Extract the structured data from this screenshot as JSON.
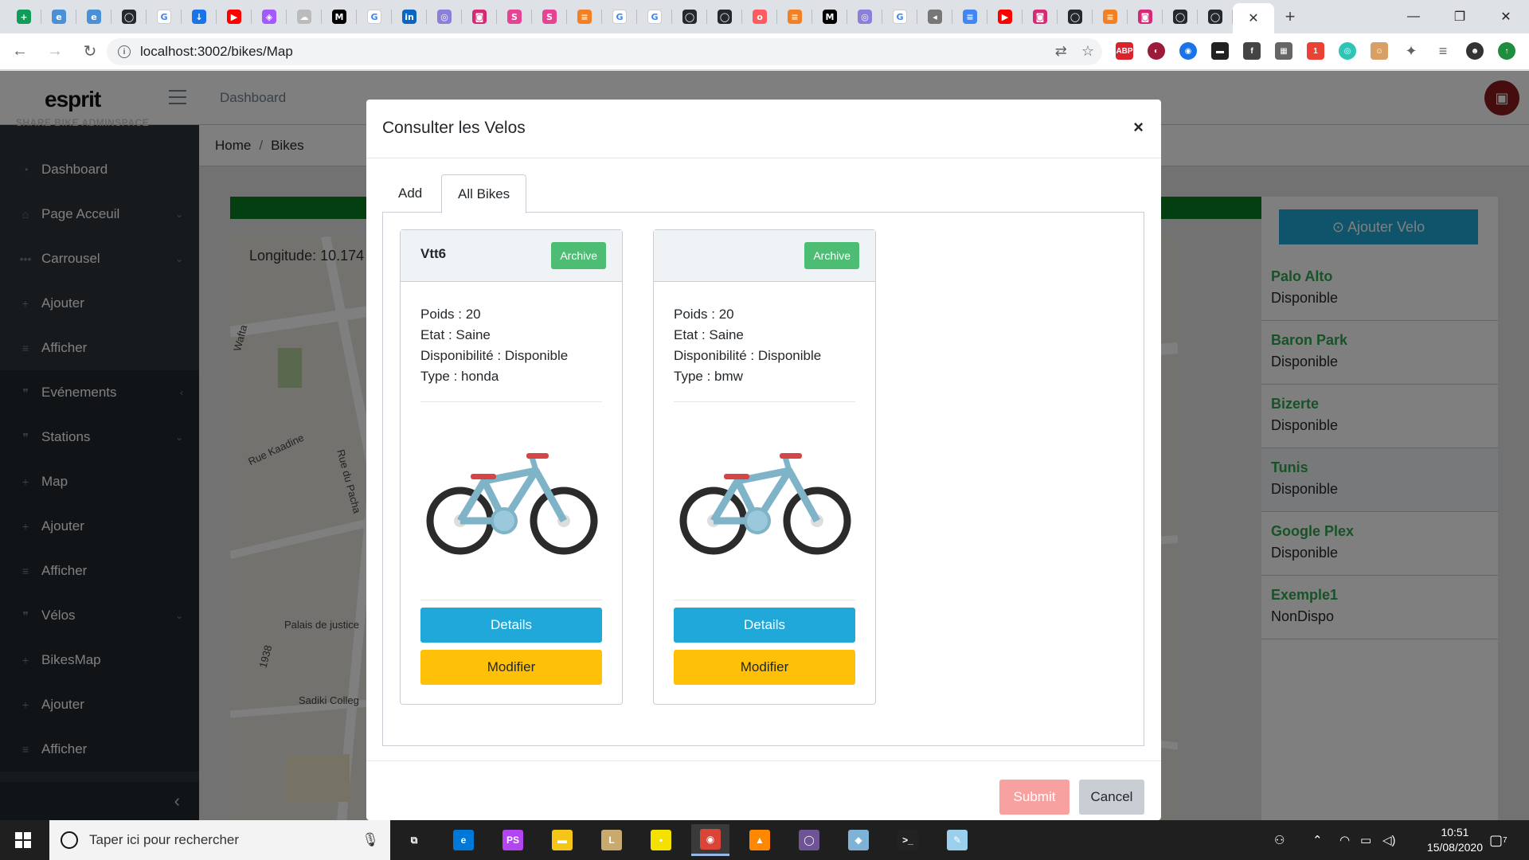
{
  "browser": {
    "tabs": [
      {
        "icon": "sheets-icon",
        "color": "#0f9d58",
        "glyph": "+"
      },
      {
        "icon": "edge-icon",
        "color": "#4a90d9",
        "glyph": "e"
      },
      {
        "icon": "edge-icon",
        "color": "#4a90d9",
        "glyph": "e"
      },
      {
        "icon": "github-icon",
        "color": "#24292e",
        "glyph": "◯"
      },
      {
        "icon": "google-icon",
        "color": "#ffffff",
        "glyph": "G"
      },
      {
        "icon": "download-icon",
        "color": "#1a73e8",
        "glyph": "↓"
      },
      {
        "icon": "youtube-icon",
        "color": "#ff0000",
        "glyph": "▶"
      },
      {
        "icon": "figma-icon",
        "color": "#a259ff",
        "glyph": "◈"
      },
      {
        "icon": "cloud-icon",
        "color": "#bbbbbb",
        "glyph": "☁"
      },
      {
        "icon": "medium-icon",
        "color": "#000000",
        "glyph": "M"
      },
      {
        "icon": "google-icon",
        "color": "#ffffff",
        "glyph": "G"
      },
      {
        "icon": "linkedin-icon",
        "color": "#0a66c2",
        "glyph": "in"
      },
      {
        "icon": "react-icon",
        "color": "#8a7fd9",
        "glyph": "◎"
      },
      {
        "icon": "instagram-icon",
        "color": "#d62976",
        "glyph": "◙"
      },
      {
        "icon": "app-icon",
        "color": "#e84393",
        "glyph": "S"
      },
      {
        "icon": "app-icon",
        "color": "#e84393",
        "glyph": "S"
      },
      {
        "icon": "stack-icon",
        "color": "#f48024",
        "glyph": "≡"
      },
      {
        "icon": "google-icon",
        "color": "#ffffff",
        "glyph": "G"
      },
      {
        "icon": "google-icon",
        "color": "#ffffff",
        "glyph": "G"
      },
      {
        "icon": "github-icon",
        "color": "#24292e",
        "glyph": "◯"
      },
      {
        "icon": "github-icon",
        "color": "#24292e",
        "glyph": "◯"
      },
      {
        "icon": "app-icon",
        "color": "#ff5a5f",
        "glyph": "o"
      },
      {
        "icon": "stack-icon",
        "color": "#f48024",
        "glyph": "≡"
      },
      {
        "icon": "medium-icon",
        "color": "#000000",
        "glyph": "M"
      },
      {
        "icon": "react-icon",
        "color": "#8a7fd9",
        "glyph": "◎"
      },
      {
        "icon": "google-icon",
        "color": "#ffffff",
        "glyph": "G"
      },
      {
        "icon": "audio-icon",
        "color": "#777777",
        "glyph": "◂"
      },
      {
        "icon": "docs-icon",
        "color": "#4285f4",
        "glyph": "≡"
      },
      {
        "icon": "youtube-icon",
        "color": "#ff0000",
        "glyph": "▶"
      },
      {
        "icon": "instagram-icon",
        "color": "#d62976",
        "glyph": "◙"
      },
      {
        "icon": "github-icon",
        "color": "#24292e",
        "glyph": "◯"
      },
      {
        "icon": "stack-icon",
        "color": "#f48024",
        "glyph": "≡"
      },
      {
        "icon": "instagram-icon",
        "color": "#d62976",
        "glyph": "◙"
      },
      {
        "icon": "github-icon",
        "color": "#24292e",
        "glyph": "◯"
      },
      {
        "icon": "github-icon",
        "color": "#24292e",
        "glyph": "◯"
      }
    ],
    "url": "localhost:3002/bikes/Map"
  },
  "app": {
    "logo_main": "esprit",
    "header_link": "Dashboard",
    "sidebar_title": "SHARE BIKE ADMINSPACE",
    "sidebar": [
      {
        "label": "Dashboard",
        "icon": "dashboard-icon",
        "chevron": ""
      },
      {
        "label": "Page Acceuil",
        "icon": "home-icon",
        "chevron": "⌄"
      },
      {
        "label": "Carrousel",
        "icon": "dots-icon",
        "chevron": "⌄"
      },
      {
        "label": "Ajouter",
        "icon": "plus-icon",
        "chevron": ""
      },
      {
        "label": "Afficher",
        "icon": "list-icon",
        "chevron": ""
      },
      {
        "label": "Evénements",
        "icon": "quote-icon",
        "chevron": "‹"
      },
      {
        "label": "Stations",
        "icon": "quote-icon",
        "chevron": "⌄"
      },
      {
        "label": "Map",
        "icon": "plus-icon",
        "chevron": ""
      },
      {
        "label": "Ajouter",
        "icon": "plus-icon",
        "chevron": ""
      },
      {
        "label": "Afficher",
        "icon": "list-icon",
        "chevron": ""
      },
      {
        "label": "Vélos",
        "icon": "quote-icon",
        "chevron": "⌄"
      },
      {
        "label": "BikesMap",
        "icon": "plus-icon",
        "chevron": ""
      },
      {
        "label": "Ajouter",
        "icon": "plus-icon",
        "chevron": ""
      },
      {
        "label": "Afficher",
        "icon": "list-icon",
        "chevron": ""
      }
    ],
    "breadcrumb": {
      "home": "Home",
      "current": "Bikes"
    },
    "map": {
      "coords": "Longitude: 10.174",
      "labels": [
        "Rue Kaadine",
        "Rue du Pacha",
        "Palais de justice",
        "Sadiki Colleg",
        "Wafta",
        "1938"
      ]
    },
    "add_velo_label": "⊙ Ajouter Velo",
    "stations": [
      {
        "name": "Palo Alto",
        "status": "Disponible",
        "active": false
      },
      {
        "name": "Baron Park",
        "status": "Disponible",
        "active": false
      },
      {
        "name": "Bizerte",
        "status": "Disponible",
        "active": false
      },
      {
        "name": "Tunis",
        "status": "Disponible",
        "active": true
      },
      {
        "name": "Google Plex",
        "status": "Disponible",
        "active": false
      },
      {
        "name": "Exemple1",
        "status": "NonDispo",
        "active": false
      }
    ]
  },
  "modal": {
    "title": "Consulter les Velos",
    "close": "×",
    "tabs": {
      "add": "Add",
      "all": "All Bikes"
    },
    "bikes": [
      {
        "name": "Vtt6",
        "archive": "Archive",
        "poids": "Poids : 20",
        "etat": "Etat : Saine",
        "dispo": "Disponibilité : Disponible",
        "type": "Type : honda",
        "details": "Details",
        "modifier": "Modifier"
      },
      {
        "name": "",
        "archive": "Archive",
        "poids": "Poids : 20",
        "etat": "Etat : Saine",
        "dispo": "Disponibilité : Disponible",
        "type": "Type : bmw",
        "details": "Details",
        "modifier": "Modifier"
      }
    ],
    "submit": "Submit",
    "cancel": "Cancel"
  },
  "taskbar": {
    "search_placeholder": "Taper ici pour rechercher",
    "time": "10:51",
    "date": "15/08/2020",
    "notifications": "7",
    "apps": [
      {
        "icon": "task-view-icon",
        "color": "#1f1f1f",
        "glyph": "⧉"
      },
      {
        "icon": "edge-icon",
        "color": "#0078d7",
        "glyph": "e"
      },
      {
        "icon": "phpstorm-icon",
        "color": "#b345f1",
        "glyph": "PS"
      },
      {
        "icon": "file-explorer-icon",
        "color": "#f5c518",
        "glyph": "▬"
      },
      {
        "icon": "league-icon",
        "color": "#c8aa6e",
        "glyph": "L"
      },
      {
        "icon": "sticky-notes-icon",
        "color": "#f5e100",
        "glyph": "▪"
      },
      {
        "icon": "chrome-icon",
        "color": "#db4437",
        "glyph": "◉"
      },
      {
        "icon": "vlc-icon",
        "color": "#ff8800",
        "glyph": "▲"
      },
      {
        "icon": "github-desktop-icon",
        "color": "#6e5494",
        "glyph": "◯"
      },
      {
        "icon": "app-icon",
        "color": "#7fb3d5",
        "glyph": "◆"
      },
      {
        "icon": "terminal-icon",
        "color": "#222222",
        "glyph": ">_"
      },
      {
        "icon": "paint-icon",
        "color": "#9ad0ec",
        "glyph": "✎"
      }
    ]
  }
}
